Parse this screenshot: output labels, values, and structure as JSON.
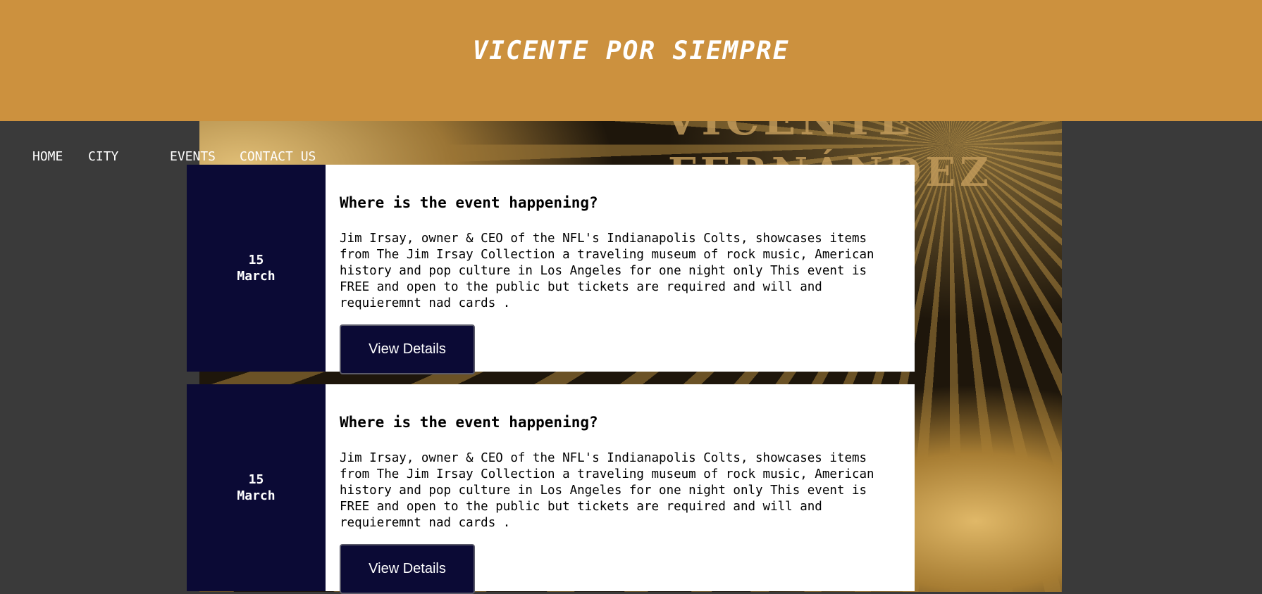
{
  "header": {
    "title": "VICENTE POR SIEMPRE"
  },
  "hero": {
    "line1": "VICENTE",
    "line2": "FERNÁNDEZ"
  },
  "nav": {
    "items": [
      "HOME",
      "CITY",
      "EVENTS",
      "CONTACT US"
    ]
  },
  "events": [
    {
      "day": "15",
      "month": "March",
      "title": "Where is the event happening?",
      "description": "Jim Irsay, owner & CEO of the NFL's Indianapolis Colts, showcases items from The Jim Irsay Collection a traveling museum of rock music, American history and pop culture in Los Angeles for one night only This event is FREE and open to the public but tickets are required and will and requieremnt nad cards .",
      "button": "View Details"
    },
    {
      "day": "15",
      "month": "March",
      "title": "Where is the event happening?",
      "description": "Jim Irsay, owner & CEO of the NFL's Indianapolis Colts, showcases items from The Jim Irsay Collection a traveling museum of rock music, American history and pop culture in Los Angeles for one night only This event is FREE and open to the public but tickets are required and will and requieremnt nad cards .",
      "button": "View Details"
    }
  ],
  "colors": {
    "header": "#cc913e",
    "page_bg": "#3a3a3a",
    "navy": "#0b0a35"
  }
}
